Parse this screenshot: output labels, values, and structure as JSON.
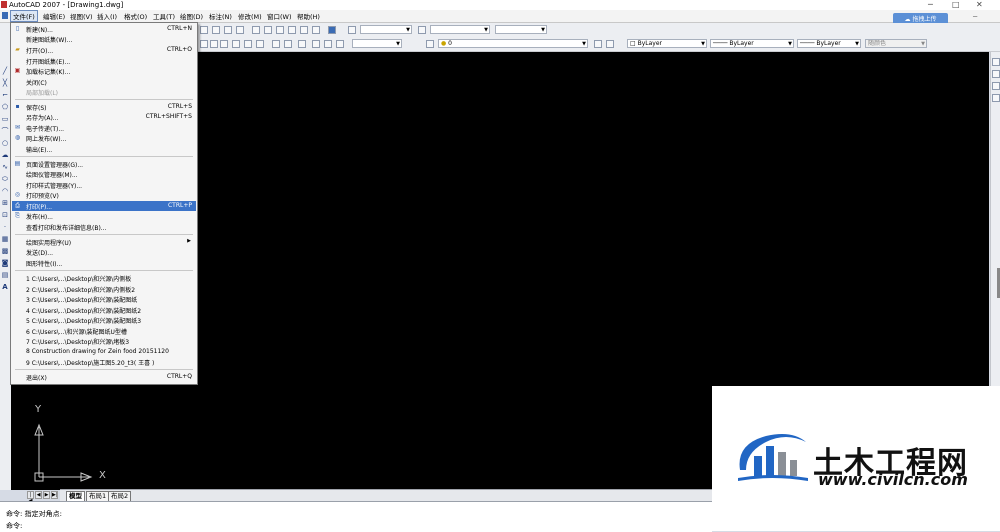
{
  "window": {
    "title": "AutoCAD 2007 - [Drawing1.dwg]"
  },
  "upload_button": "拖拽上传",
  "menubar": [
    "文件(F)",
    "编辑(E)",
    "视图(V)",
    "插入(I)",
    "格式(O)",
    "工具(T)",
    "绘图(D)",
    "标注(N)",
    "修改(M)",
    "窗口(W)",
    "帮助(H)"
  ],
  "toolbar": {
    "layer_value": "0",
    "color_value": "ByLayer",
    "linetype_value": "ByLayer",
    "lineweight_value": "ByLayer",
    "plotstyle_value": "随颜色"
  },
  "file_menu": {
    "items": [
      {
        "label": "新建(N)...",
        "shortcut": "CTRL+N",
        "icon": "new-icon"
      },
      {
        "label": "新建图纸集(W)...",
        "shortcut": "",
        "icon": ""
      },
      {
        "label": "打开(O)...",
        "shortcut": "CTRL+O",
        "icon": "open-icon"
      },
      {
        "label": "打开图纸集(E)...",
        "shortcut": "",
        "icon": ""
      },
      {
        "label": "加载标记集(K)...",
        "shortcut": "",
        "icon": "markup-icon"
      },
      {
        "label": "关闭(C)",
        "shortcut": "",
        "icon": ""
      },
      {
        "label": "局部加载(L)",
        "shortcut": "",
        "icon": "",
        "disabled": true
      },
      {
        "label": "保存(S)",
        "shortcut": "CTRL+S",
        "icon": "save-icon"
      },
      {
        "label": "另存为(A)...",
        "shortcut": "CTRL+SHIFT+S",
        "icon": ""
      },
      {
        "label": "电子传递(T)...",
        "shortcut": "",
        "icon": "etransmit-icon"
      },
      {
        "label": "网上发布(W)...",
        "shortcut": "",
        "icon": "publish-web-icon"
      },
      {
        "label": "输出(E)...",
        "shortcut": "",
        "icon": ""
      },
      {
        "label": "页面设置管理器(G)...",
        "shortcut": "",
        "icon": "page-setup-icon"
      },
      {
        "label": "绘图仪管理器(M)...",
        "shortcut": "",
        "icon": ""
      },
      {
        "label": "打印样式管理器(Y)...",
        "shortcut": "",
        "icon": ""
      },
      {
        "label": "打印预览(V)",
        "shortcut": "",
        "icon": "preview-icon"
      },
      {
        "label": "打印(P)...",
        "shortcut": "CTRL+P",
        "icon": "print-icon",
        "highlighted": true
      },
      {
        "label": "发布(H)...",
        "shortcut": "",
        "icon": "publish-icon"
      },
      {
        "label": "查看打印和发布详细信息(B)...",
        "shortcut": "",
        "icon": ""
      },
      {
        "label": "绘图实用程序(U)",
        "shortcut": "",
        "icon": "",
        "submenu": true
      },
      {
        "label": "发送(D)...",
        "shortcut": "",
        "icon": ""
      },
      {
        "label": "图形特性(I)...",
        "shortcut": "",
        "icon": ""
      },
      {
        "label": "1 C:\\Users\\...\\Desktop\\和兴源\\内侧板",
        "shortcut": "",
        "icon": ""
      },
      {
        "label": "2 C:\\Users\\...\\Desktop\\和兴源\\内侧板2",
        "shortcut": "",
        "icon": ""
      },
      {
        "label": "3 C:\\Users\\...\\Desktop\\和兴源\\装配图纸",
        "shortcut": "",
        "icon": ""
      },
      {
        "label": "4 C:\\Users\\...\\Desktop\\和兴源\\装配图纸2",
        "shortcut": "",
        "icon": ""
      },
      {
        "label": "5 C:\\Users\\...\\Desktop\\和兴源\\装配图纸3",
        "shortcut": "",
        "icon": ""
      },
      {
        "label": "6 C:\\Users\\...\\和兴源\\装配图纸U型槽",
        "shortcut": "",
        "icon": ""
      },
      {
        "label": "7 C:\\Users\\...\\Desktop\\和兴源\\堵板3",
        "shortcut": "",
        "icon": ""
      },
      {
        "label": "8 Construction drawing for Zein food 20151120",
        "shortcut": "",
        "icon": ""
      },
      {
        "label": "9 C:\\Users\\...\\Desktop\\施工图5.20_t3( 王喜 )",
        "shortcut": "",
        "icon": ""
      },
      {
        "label": "退出(X)",
        "shortcut": "CTRL+Q",
        "icon": ""
      }
    ]
  },
  "ucs": {
    "x_label": "X",
    "y_label": "Y"
  },
  "tabs": [
    "模型",
    "布局1",
    "布局2"
  ],
  "command": {
    "line1": "命令: 指定对角点:",
    "line2": "命令:"
  },
  "watermark": {
    "name": "土木工程网",
    "url": "www.civilcn.com"
  },
  "colors": {
    "canvas": "#000000",
    "highlight": "#3b73c8",
    "logo_blue": "#2166c4",
    "logo_gray": "#8a8f96"
  }
}
